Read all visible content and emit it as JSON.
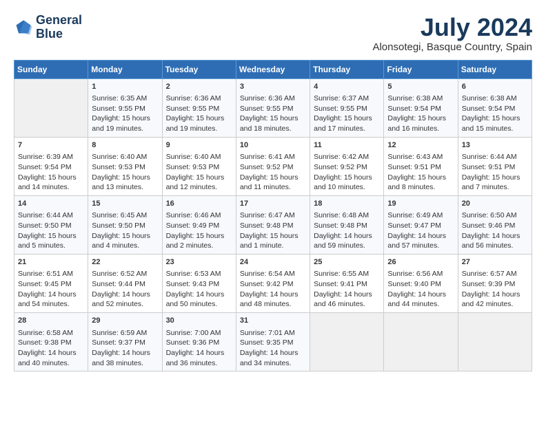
{
  "header": {
    "logo_line1": "General",
    "logo_line2": "Blue",
    "month_year": "July 2024",
    "location": "Alonsotegi, Basque Country, Spain"
  },
  "weekdays": [
    "Sunday",
    "Monday",
    "Tuesday",
    "Wednesday",
    "Thursday",
    "Friday",
    "Saturday"
  ],
  "weeks": [
    [
      {
        "day": "",
        "empty": true
      },
      {
        "day": "1",
        "line1": "Sunrise: 6:35 AM",
        "line2": "Sunset: 9:55 PM",
        "line3": "Daylight: 15 hours",
        "line4": "and 19 minutes."
      },
      {
        "day": "2",
        "line1": "Sunrise: 6:36 AM",
        "line2": "Sunset: 9:55 PM",
        "line3": "Daylight: 15 hours",
        "line4": "and 19 minutes."
      },
      {
        "day": "3",
        "line1": "Sunrise: 6:36 AM",
        "line2": "Sunset: 9:55 PM",
        "line3": "Daylight: 15 hours",
        "line4": "and 18 minutes."
      },
      {
        "day": "4",
        "line1": "Sunrise: 6:37 AM",
        "line2": "Sunset: 9:55 PM",
        "line3": "Daylight: 15 hours",
        "line4": "and 17 minutes."
      },
      {
        "day": "5",
        "line1": "Sunrise: 6:38 AM",
        "line2": "Sunset: 9:54 PM",
        "line3": "Daylight: 15 hours",
        "line4": "and 16 minutes."
      },
      {
        "day": "6",
        "line1": "Sunrise: 6:38 AM",
        "line2": "Sunset: 9:54 PM",
        "line3": "Daylight: 15 hours",
        "line4": "and 15 minutes."
      }
    ],
    [
      {
        "day": "7",
        "line1": "Sunrise: 6:39 AM",
        "line2": "Sunset: 9:54 PM",
        "line3": "Daylight: 15 hours",
        "line4": "and 14 minutes."
      },
      {
        "day": "8",
        "line1": "Sunrise: 6:40 AM",
        "line2": "Sunset: 9:53 PM",
        "line3": "Daylight: 15 hours",
        "line4": "and 13 minutes."
      },
      {
        "day": "9",
        "line1": "Sunrise: 6:40 AM",
        "line2": "Sunset: 9:53 PM",
        "line3": "Daylight: 15 hours",
        "line4": "and 12 minutes."
      },
      {
        "day": "10",
        "line1": "Sunrise: 6:41 AM",
        "line2": "Sunset: 9:52 PM",
        "line3": "Daylight: 15 hours",
        "line4": "and 11 minutes."
      },
      {
        "day": "11",
        "line1": "Sunrise: 6:42 AM",
        "line2": "Sunset: 9:52 PM",
        "line3": "Daylight: 15 hours",
        "line4": "and 10 minutes."
      },
      {
        "day": "12",
        "line1": "Sunrise: 6:43 AM",
        "line2": "Sunset: 9:51 PM",
        "line3": "Daylight: 15 hours",
        "line4": "and 8 minutes."
      },
      {
        "day": "13",
        "line1": "Sunrise: 6:44 AM",
        "line2": "Sunset: 9:51 PM",
        "line3": "Daylight: 15 hours",
        "line4": "and 7 minutes."
      }
    ],
    [
      {
        "day": "14",
        "line1": "Sunrise: 6:44 AM",
        "line2": "Sunset: 9:50 PM",
        "line3": "Daylight: 15 hours",
        "line4": "and 5 minutes."
      },
      {
        "day": "15",
        "line1": "Sunrise: 6:45 AM",
        "line2": "Sunset: 9:50 PM",
        "line3": "Daylight: 15 hours",
        "line4": "and 4 minutes."
      },
      {
        "day": "16",
        "line1": "Sunrise: 6:46 AM",
        "line2": "Sunset: 9:49 PM",
        "line3": "Daylight: 15 hours",
        "line4": "and 2 minutes."
      },
      {
        "day": "17",
        "line1": "Sunrise: 6:47 AM",
        "line2": "Sunset: 9:48 PM",
        "line3": "Daylight: 15 hours",
        "line4": "and 1 minute."
      },
      {
        "day": "18",
        "line1": "Sunrise: 6:48 AM",
        "line2": "Sunset: 9:48 PM",
        "line3": "Daylight: 14 hours",
        "line4": "and 59 minutes."
      },
      {
        "day": "19",
        "line1": "Sunrise: 6:49 AM",
        "line2": "Sunset: 9:47 PM",
        "line3": "Daylight: 14 hours",
        "line4": "and 57 minutes."
      },
      {
        "day": "20",
        "line1": "Sunrise: 6:50 AM",
        "line2": "Sunset: 9:46 PM",
        "line3": "Daylight: 14 hours",
        "line4": "and 56 minutes."
      }
    ],
    [
      {
        "day": "21",
        "line1": "Sunrise: 6:51 AM",
        "line2": "Sunset: 9:45 PM",
        "line3": "Daylight: 14 hours",
        "line4": "and 54 minutes."
      },
      {
        "day": "22",
        "line1": "Sunrise: 6:52 AM",
        "line2": "Sunset: 9:44 PM",
        "line3": "Daylight: 14 hours",
        "line4": "and 52 minutes."
      },
      {
        "day": "23",
        "line1": "Sunrise: 6:53 AM",
        "line2": "Sunset: 9:43 PM",
        "line3": "Daylight: 14 hours",
        "line4": "and 50 minutes."
      },
      {
        "day": "24",
        "line1": "Sunrise: 6:54 AM",
        "line2": "Sunset: 9:42 PM",
        "line3": "Daylight: 14 hours",
        "line4": "and 48 minutes."
      },
      {
        "day": "25",
        "line1": "Sunrise: 6:55 AM",
        "line2": "Sunset: 9:41 PM",
        "line3": "Daylight: 14 hours",
        "line4": "and 46 minutes."
      },
      {
        "day": "26",
        "line1": "Sunrise: 6:56 AM",
        "line2": "Sunset: 9:40 PM",
        "line3": "Daylight: 14 hours",
        "line4": "and 44 minutes."
      },
      {
        "day": "27",
        "line1": "Sunrise: 6:57 AM",
        "line2": "Sunset: 9:39 PM",
        "line3": "Daylight: 14 hours",
        "line4": "and 42 minutes."
      }
    ],
    [
      {
        "day": "28",
        "line1": "Sunrise: 6:58 AM",
        "line2": "Sunset: 9:38 PM",
        "line3": "Daylight: 14 hours",
        "line4": "and 40 minutes."
      },
      {
        "day": "29",
        "line1": "Sunrise: 6:59 AM",
        "line2": "Sunset: 9:37 PM",
        "line3": "Daylight: 14 hours",
        "line4": "and 38 minutes."
      },
      {
        "day": "30",
        "line1": "Sunrise: 7:00 AM",
        "line2": "Sunset: 9:36 PM",
        "line3": "Daylight: 14 hours",
        "line4": "and 36 minutes."
      },
      {
        "day": "31",
        "line1": "Sunrise: 7:01 AM",
        "line2": "Sunset: 9:35 PM",
        "line3": "Daylight: 14 hours",
        "line4": "and 34 minutes."
      },
      {
        "day": "",
        "empty": true
      },
      {
        "day": "",
        "empty": true
      },
      {
        "day": "",
        "empty": true
      }
    ]
  ]
}
